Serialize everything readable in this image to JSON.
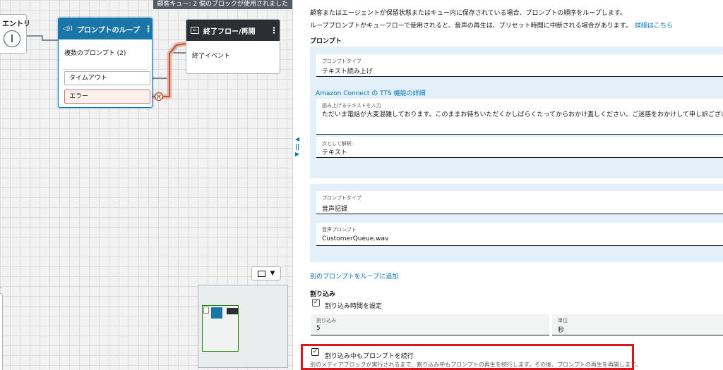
{
  "canvas": {
    "usage_banner": "顧客キュー: 2 個のブロックが使用されました",
    "entry_block": {
      "title": "エントリ"
    },
    "prompt_block": {
      "title": "プロンプトのループ",
      "subtitle": "複数のプロンプト (2)",
      "branch_timeout": "タイムアウト",
      "branch_error": "エラー"
    },
    "end_block": {
      "title": "終了フロー/再開",
      "subtitle": "終了イベント"
    },
    "zoom_dropdown_arrow": "▼"
  },
  "panel": {
    "desc1": "顧客またはエージェントが保留状態またはキュー内に保存されている場合、プロンプトの順序をループします。",
    "desc2": "ループプロンプトがキューフローで使用されると、音声の再生は、プリセット時間に中断される場合があります。",
    "learn_more": "詳細はこちら",
    "prompts_heading": "プロンプト",
    "prompt1": {
      "type_label": "プロンプトタイプ",
      "type_value": "テキスト読み上げ",
      "tts_link": "Amazon Connect の TTS 機能の詳細",
      "text_label": "読み上げるテキストを入力",
      "text_value": "ただいま電話が大変混雑しております。このままお待ちいただくかしばらくたってからおかけ直しください。ご迷惑をおかけして申し訳ございません。",
      "interpret_label": "次として解釈:",
      "interpret_value": "テキスト"
    },
    "prompt2": {
      "type_label": "プロンプトタイプ",
      "type_value": "音声記録",
      "audio_label": "音声プロンプト",
      "audio_value": "CustomerQueue.wav"
    },
    "add_prompt_link": "別のプロンプトをループに追加",
    "interrupt_heading": "割り込み",
    "set_interrupt_label": "割り込み時間を設定",
    "set_interrupt_checked": true,
    "interrupt_field_label": "割り込み",
    "interrupt_value": "5",
    "unit_label": "単位",
    "unit_value": "秒",
    "continue_label": "割り込み中もプロンプトを続行",
    "continue_checked": true,
    "continue_help": "別のメディアブロックが実行されるまで、割り込み中もプロンプトの再生を続行します。その後、プロンプトの再生を再開します。"
  },
  "colors": {
    "prompt_header": "#1a76a6",
    "end_header": "#2b2f33",
    "link": "#0073bb",
    "error_wire": "#b5553f",
    "highlight": "#e0131d",
    "prompt_group_bg": "#e3f0fa"
  },
  "icons": {
    "prompt_icon": "speaker-icon",
    "end_icon": "exit-icon",
    "error_marker": "close-circle-icon",
    "fit_icon": "fit-to-screen-icon"
  }
}
